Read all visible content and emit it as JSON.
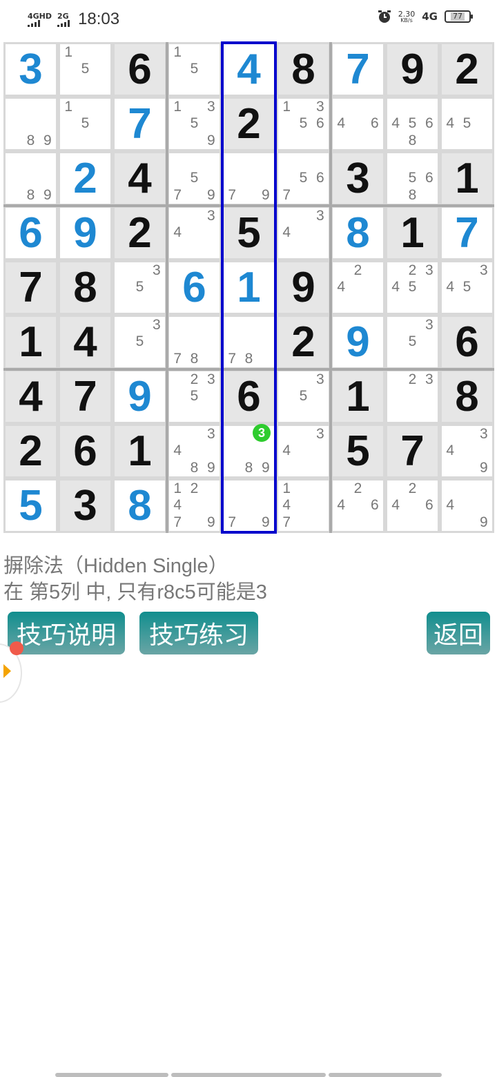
{
  "status_bar": {
    "signal1_label": "4GHD",
    "signal2_label": "2G",
    "time": "18:03",
    "net_speed": "2.30",
    "net_unit": "KB/s",
    "net_type": "4G",
    "battery": "77"
  },
  "sudoku": {
    "highlight_column": 5,
    "hint_cell": {
      "row": 8,
      "col": 5,
      "digit": "3"
    },
    "cells": [
      [
        {
          "v": "3",
          "c": "blue"
        },
        {
          "cand": [
            1,
            5
          ]
        },
        {
          "v": "6",
          "c": "black"
        },
        {
          "cand": [
            1,
            5
          ]
        },
        {
          "v": "4",
          "c": "blue"
        },
        {
          "v": "8",
          "c": "black"
        },
        {
          "v": "7",
          "c": "blue"
        },
        {
          "v": "9",
          "c": "black"
        },
        {
          "v": "2",
          "c": "black"
        }
      ],
      [
        {
          "cand": [
            8,
            9
          ]
        },
        {
          "cand": [
            1,
            5
          ]
        },
        {
          "v": "7",
          "c": "blue"
        },
        {
          "cand": [
            1,
            3,
            5,
            9
          ]
        },
        {
          "v": "2",
          "c": "black"
        },
        {
          "cand": [
            1,
            3,
            5,
            6
          ]
        },
        {
          "cand": [
            4,
            6
          ]
        },
        {
          "cand": [
            4,
            5,
            6,
            8
          ]
        },
        {
          "cand": [
            4,
            5
          ]
        }
      ],
      [
        {
          "cand": [
            8,
            9
          ]
        },
        {
          "v": "2",
          "c": "blue"
        },
        {
          "v": "4",
          "c": "black"
        },
        {
          "cand": [
            5,
            7,
            9
          ]
        },
        {
          "cand": [
            7,
            9
          ]
        },
        {
          "cand": [
            5,
            6,
            7
          ]
        },
        {
          "v": "3",
          "c": "black"
        },
        {
          "cand": [
            5,
            6,
            8
          ]
        },
        {
          "v": "1",
          "c": "black"
        }
      ],
      [
        {
          "v": "6",
          "c": "blue"
        },
        {
          "v": "9",
          "c": "blue"
        },
        {
          "v": "2",
          "c": "black"
        },
        {
          "cand": [
            3,
            4
          ]
        },
        {
          "v": "5",
          "c": "black"
        },
        {
          "cand": [
            3,
            4
          ]
        },
        {
          "v": "8",
          "c": "blue"
        },
        {
          "v": "1",
          "c": "black"
        },
        {
          "v": "7",
          "c": "blue"
        }
      ],
      [
        {
          "v": "7",
          "c": "black"
        },
        {
          "v": "8",
          "c": "black"
        },
        {
          "cand": [
            3,
            5
          ]
        },
        {
          "v": "6",
          "c": "blue"
        },
        {
          "v": "1",
          "c": "blue"
        },
        {
          "v": "9",
          "c": "black"
        },
        {
          "cand": [
            2,
            4
          ]
        },
        {
          "cand": [
            2,
            3,
            4,
            5
          ]
        },
        {
          "cand": [
            3,
            4,
            5
          ]
        }
      ],
      [
        {
          "v": "1",
          "c": "black"
        },
        {
          "v": "4",
          "c": "black"
        },
        {
          "cand": [
            3,
            5
          ]
        },
        {
          "cand": [
            7,
            8
          ]
        },
        {
          "cand": [
            7,
            8
          ]
        },
        {
          "v": "2",
          "c": "black"
        },
        {
          "v": "9",
          "c": "blue"
        },
        {
          "cand": [
            3,
            5
          ]
        },
        {
          "v": "6",
          "c": "black"
        }
      ],
      [
        {
          "v": "4",
          "c": "black"
        },
        {
          "v": "7",
          "c": "black"
        },
        {
          "v": "9",
          "c": "blue"
        },
        {
          "cand": [
            2,
            3,
            5
          ]
        },
        {
          "v": "6",
          "c": "black"
        },
        {
          "cand": [
            3,
            5
          ]
        },
        {
          "v": "1",
          "c": "black"
        },
        {
          "cand": [
            2,
            3
          ]
        },
        {
          "v": "8",
          "c": "black"
        }
      ],
      [
        {
          "v": "2",
          "c": "black"
        },
        {
          "v": "6",
          "c": "black"
        },
        {
          "v": "1",
          "c": "black"
        },
        {
          "cand": [
            3,
            4,
            8,
            9
          ]
        },
        {
          "cand": [
            8,
            9
          ]
        },
        {
          "cand": [
            3,
            4
          ]
        },
        {
          "v": "5",
          "c": "black"
        },
        {
          "v": "7",
          "c": "black"
        },
        {
          "cand": [
            3,
            4,
            9
          ]
        }
      ],
      [
        {
          "v": "5",
          "c": "blue"
        },
        {
          "v": "3",
          "c": "black"
        },
        {
          "v": "8",
          "c": "blue"
        },
        {
          "cand": [
            1,
            2,
            4,
            7,
            9
          ]
        },
        {
          "cand": [
            7,
            9
          ]
        },
        {
          "cand": [
            1,
            4,
            7
          ]
        },
        {
          "cand": [
            2,
            4,
            6
          ]
        },
        {
          "cand": [
            2,
            4,
            6
          ]
        },
        {
          "cand": [
            4,
            9
          ]
        }
      ]
    ]
  },
  "hint": {
    "title": "摒除法（Hidden Single）",
    "description": "在 第5列 中, 只有r8c5可能是3"
  },
  "buttons": {
    "explain": "技巧说明",
    "practice": "技巧练习",
    "back": "返回"
  },
  "colors": {
    "given_blue": "#1e88d2",
    "given_black": "#111111",
    "candidate": "#777777",
    "highlight": "#0000cc",
    "hint_dot": "#2ecc2e",
    "button_top": "#118e8e",
    "button_bottom": "#6aa5a5"
  }
}
